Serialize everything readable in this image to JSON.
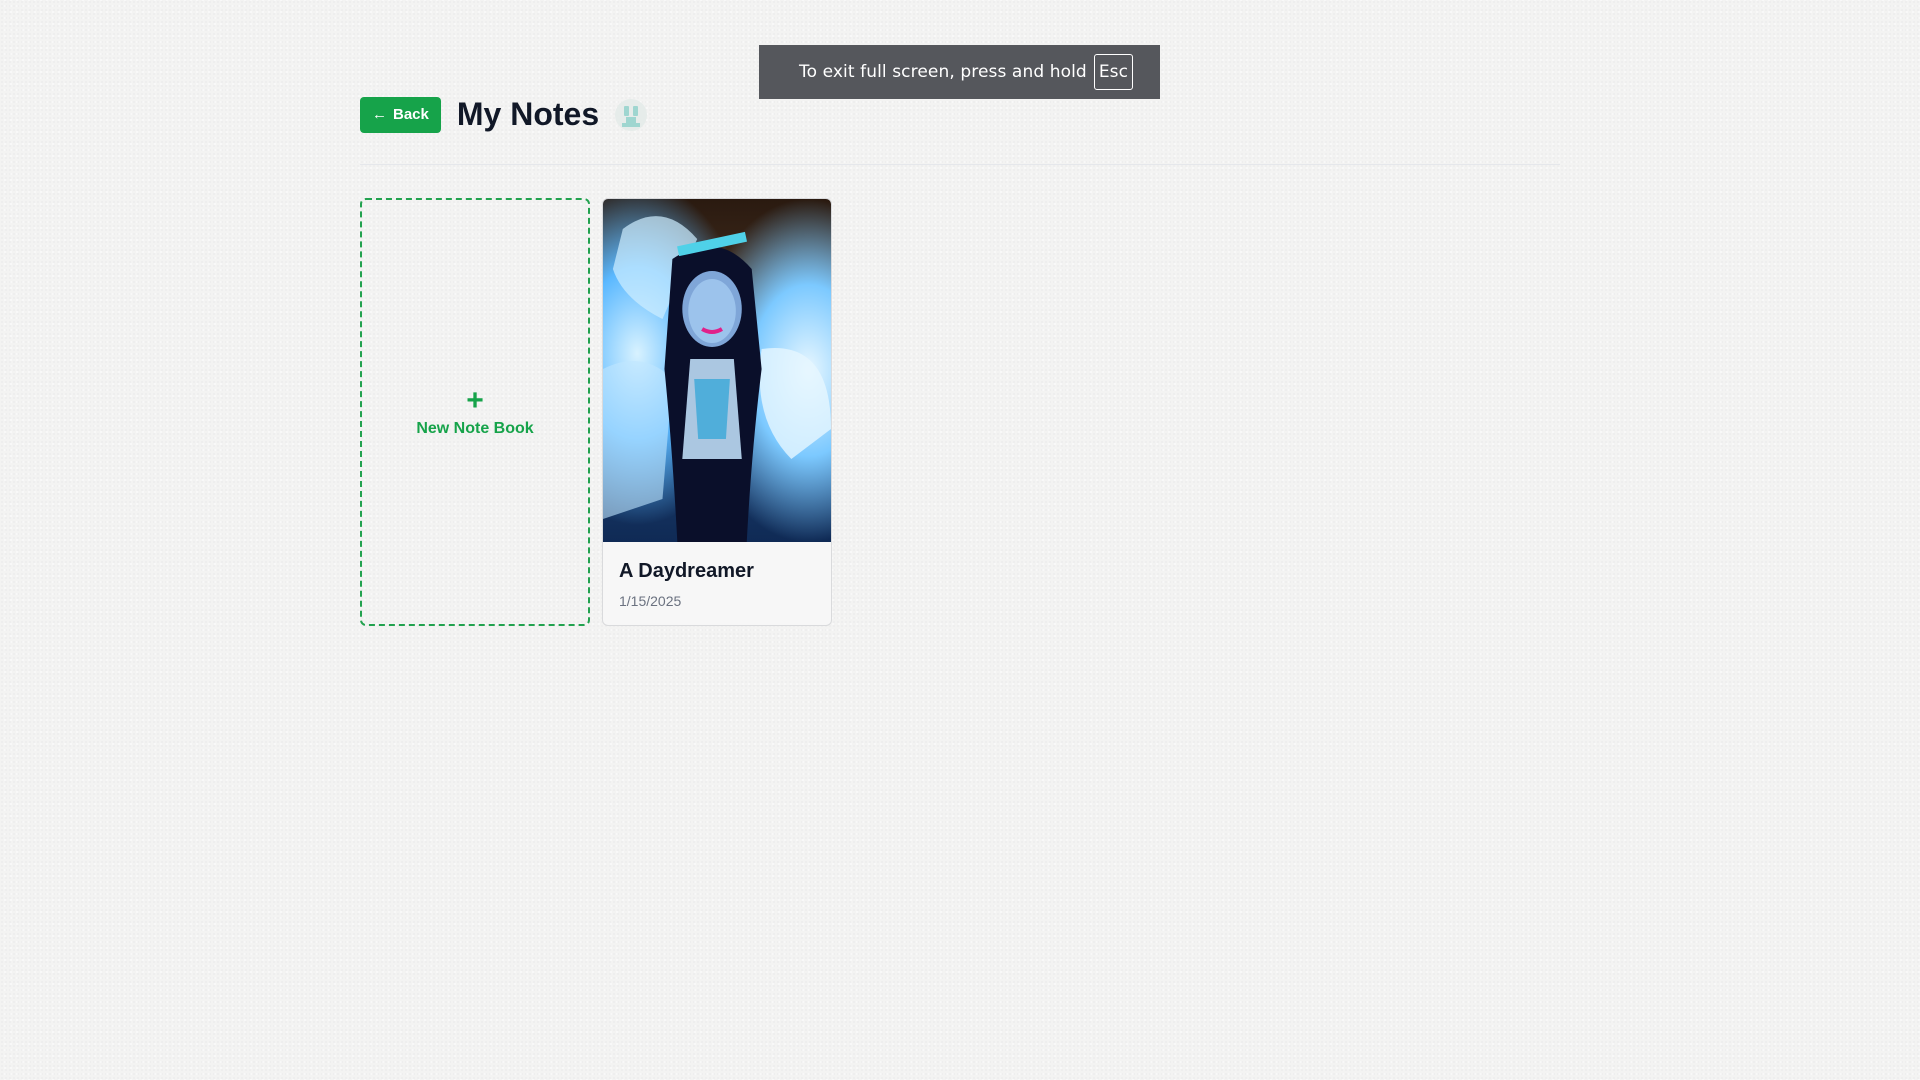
{
  "fullscreen_toast": {
    "message": "To exit full screen, press and hold",
    "key": "Esc"
  },
  "header": {
    "back_label": "Back",
    "title": "My Notes",
    "back_icon": "arrow-left-icon",
    "avatar_icon": "pixel-avatar"
  },
  "new_notebook": {
    "icon": "+",
    "label": "New Note Book"
  },
  "notebooks": [
    {
      "title": "A Daydreamer",
      "date": "1/15/2025"
    }
  ],
  "colors": {
    "accent": "#16a34a",
    "background": "#f3f3f2",
    "toast": "#55575c"
  }
}
